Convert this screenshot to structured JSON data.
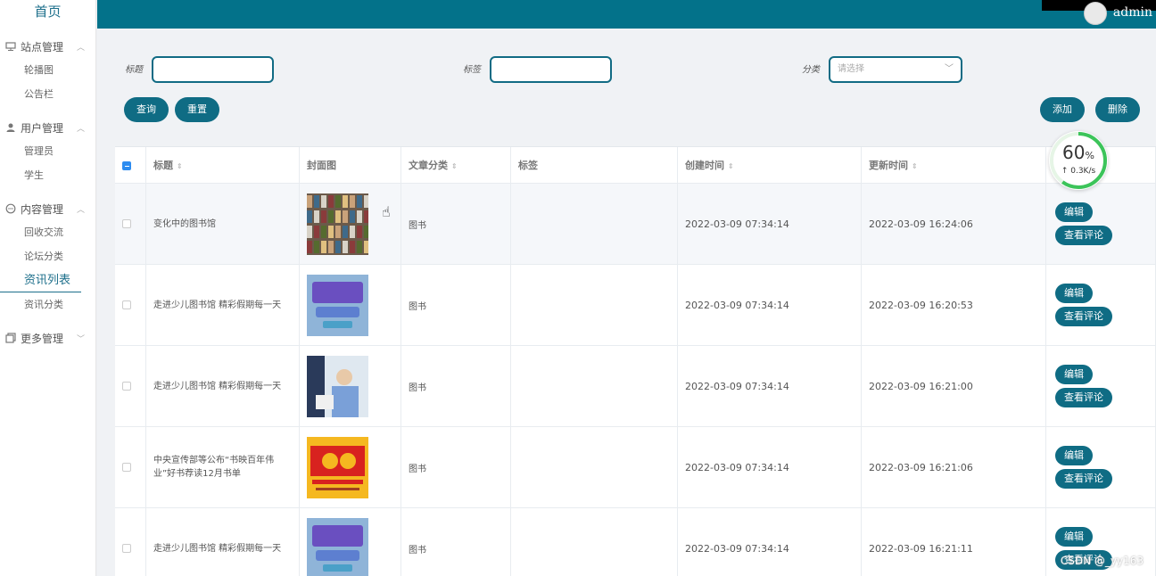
{
  "sidebar": {
    "home": "首页",
    "groups": [
      {
        "label": "站点管理",
        "icon": "monitor-icon",
        "items": [
          "轮播图",
          "公告栏"
        ]
      },
      {
        "label": "用户管理",
        "icon": "user-icon",
        "items": [
          "管理员",
          "学生"
        ]
      },
      {
        "label": "内容管理",
        "icon": "chat-icon",
        "items": [
          "回收交流",
          "论坛分类",
          "资讯列表",
          "资讯分类"
        ]
      },
      {
        "label": "更多管理",
        "icon": "copy-icon",
        "items": []
      }
    ],
    "active_item": "资讯列表"
  },
  "topbar": {
    "username": "admin"
  },
  "search": {
    "title_label": "标题",
    "tag_label": "标签",
    "category_label": "分类",
    "category_placeholder": "请选择",
    "query_button": "查询",
    "reset_button": "重置",
    "add_button": "添加",
    "delete_button": "删除"
  },
  "table": {
    "headers": [
      "标题",
      "封面图",
      "文章分类",
      "标签",
      "创建时间",
      "更新时间"
    ],
    "rows": [
      {
        "title": "变化中的图书馆",
        "category": "图书",
        "tag": "",
        "created": "2022-03-09 07:34:14",
        "updated": "2022-03-09 16:24:06",
        "thumb": "library"
      },
      {
        "title": "走进少儿图书馆 精彩假期每一天",
        "category": "图书",
        "tag": "",
        "created": "2022-03-09 07:34:14",
        "updated": "2022-03-09 16:20:53",
        "thumb": "poster"
      },
      {
        "title": "走进少儿图书馆 精彩假期每一天",
        "category": "图书",
        "tag": "",
        "created": "2022-03-09 07:34:14",
        "updated": "2022-03-09 16:21:00",
        "thumb": "photo"
      },
      {
        "title": "中央宣传部等公布“书映百年伟业”好书荐读12月书单",
        "category": "图书",
        "tag": "",
        "created": "2022-03-09 07:34:14",
        "updated": "2022-03-09 16:21:06",
        "thumb": "centenary"
      },
      {
        "title": "走进少儿图书馆 精彩假期每一天",
        "category": "图书",
        "tag": "",
        "created": "2022-03-09 07:34:14",
        "updated": "2022-03-09 16:21:11",
        "thumb": "poster"
      }
    ],
    "edit_label": "编辑",
    "comment_label": "查看评论"
  },
  "progress": {
    "percent": "60",
    "unit": "%",
    "speed": "↑ 0.3K/s"
  },
  "watermark": "CSDN @_yy163",
  "colors": {
    "primary": "#0f6c84",
    "topbar": "#03728a"
  }
}
